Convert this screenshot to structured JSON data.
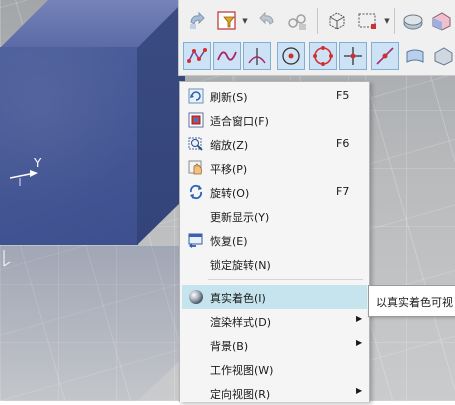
{
  "viewport": {
    "axis_label": "Y"
  },
  "toolbar": {
    "row1": [
      "undo-icon",
      "filter-select-icon",
      "redo-icon",
      "link-icon",
      "view-cube-icon",
      "box-select-icon",
      "part-icon",
      "shade-icon"
    ],
    "row2": [
      "spline-points-icon",
      "curve-icon",
      "angle-icon",
      "point-on-curve-icon",
      "circle-center-icon",
      "cross-point-icon",
      "line-point-icon",
      "surface-icon"
    ],
    "active_color": "#cde3f5"
  },
  "context_menu": {
    "items": [
      {
        "label": "刷新(S)",
        "shortcut": "F5",
        "icon": "refresh-icon"
      },
      {
        "label": "适合窗口(F)",
        "shortcut": "",
        "icon": "fit-window-icon"
      },
      {
        "label": "缩放(Z)",
        "shortcut": "F6",
        "icon": "zoom-icon"
      },
      {
        "label": "平移(P)",
        "shortcut": "",
        "icon": "pan-icon"
      },
      {
        "label": "旋转(O)",
        "shortcut": "F7",
        "icon": "rotate-icon"
      },
      {
        "label": "更新显示(Y)",
        "shortcut": "",
        "icon": ""
      },
      {
        "label": "恢复(E)",
        "shortcut": "",
        "icon": "restore-icon"
      },
      {
        "label": "锁定旋转(N)",
        "shortcut": "",
        "icon": ""
      },
      {
        "label": "真实着色(I)",
        "shortcut": "",
        "icon": "true-shading-icon"
      },
      {
        "label": "渲染样式(D)",
        "shortcut": "",
        "icon": ""
      },
      {
        "label": "背景(B)",
        "shortcut": "",
        "icon": ""
      },
      {
        "label": "工作视图(W)",
        "shortcut": "",
        "icon": ""
      },
      {
        "label": "定向视图(R)",
        "shortcut": "",
        "icon": ""
      }
    ],
    "highlight_color": "#c6e4ee"
  },
  "tooltip": {
    "text": "以真实着色可视"
  }
}
